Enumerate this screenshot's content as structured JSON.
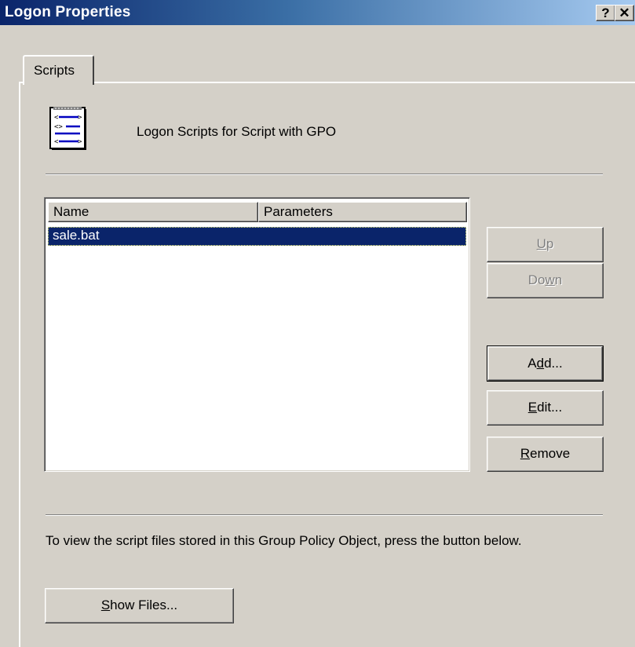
{
  "window": {
    "title": "Logon Properties",
    "help_glyph": "?",
    "close_glyph": "✕",
    "accent": "#0a246a"
  },
  "tabs": [
    {
      "label": "Scripts",
      "selected": true
    }
  ],
  "header": {
    "icon": "script-file-icon",
    "text": "Logon Scripts for Script with GPO"
  },
  "list": {
    "columns": [
      "Name",
      "Parameters"
    ],
    "rows": [
      {
        "name": "sale.bat",
        "parameters": "",
        "selected": true
      }
    ]
  },
  "buttons": {
    "up": "Up",
    "down": "Down",
    "add": "Add...",
    "edit": "Edit...",
    "remove": "Remove",
    "show_files": "Show Files..."
  },
  "info_text": "To view the script files stored in this Group Policy Object, press the button below."
}
